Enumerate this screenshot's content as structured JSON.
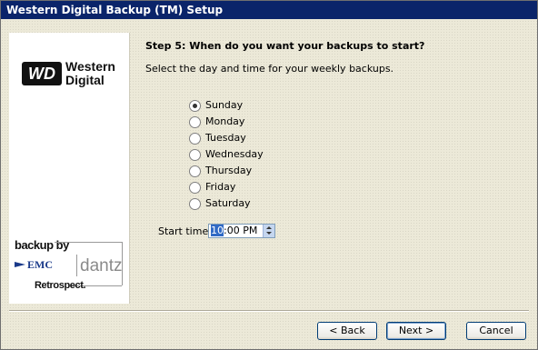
{
  "window": {
    "title": "Western Digital Backup (TM) Setup"
  },
  "brand": {
    "wd_box": "WD",
    "wd_word_line1": "Western",
    "wd_word_line2": "Digital",
    "backup_by": "backup by",
    "emc": "EMC",
    "dantz": "dantz",
    "retrospect": "Retrospect."
  },
  "step": {
    "title": "Step 5: When do you want your backups to start?",
    "description": "Select the day and time for your weekly backups."
  },
  "days": [
    {
      "label": "Sunday",
      "checked": true
    },
    {
      "label": "Monday",
      "checked": false
    },
    {
      "label": "Tuesday",
      "checked": false
    },
    {
      "label": "Wednesday",
      "checked": false
    },
    {
      "label": "Thursday",
      "checked": false
    },
    {
      "label": "Friday",
      "checked": false
    },
    {
      "label": "Saturday",
      "checked": false
    }
  ],
  "start_time": {
    "label": "Start time:",
    "hour": "10",
    "rest": ":00 PM"
  },
  "buttons": {
    "back": "< Back",
    "next": "Next >",
    "cancel": "Cancel"
  },
  "colors": {
    "titlebar": "#0a246a",
    "selection": "#316ac5",
    "button_border": "#003c74"
  }
}
